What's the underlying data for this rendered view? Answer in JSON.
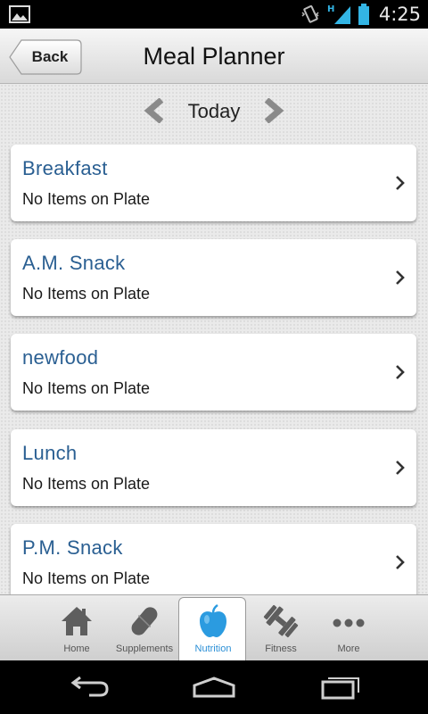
{
  "status_bar": {
    "time": "4:25",
    "network": "H",
    "icons": [
      "gallery-icon",
      "vibrate-icon",
      "signal-icon",
      "battery-icon"
    ]
  },
  "header": {
    "back_label": "Back",
    "title": "Meal Planner"
  },
  "date_nav": {
    "label": "Today"
  },
  "meals": [
    {
      "name": "Breakfast",
      "status": "No Items on Plate"
    },
    {
      "name": "A.M. Snack",
      "status": "No Items on Plate"
    },
    {
      "name": "newfood",
      "status": "No Items on Plate"
    },
    {
      "name": "Lunch",
      "status": "No Items on Plate"
    },
    {
      "name": "P.M. Snack",
      "status": "No Items on Plate"
    }
  ],
  "tabs": [
    {
      "label": "Home",
      "icon": "home-icon"
    },
    {
      "label": "Supplements",
      "icon": "pill-icon"
    },
    {
      "label": "Nutrition",
      "icon": "apple-icon",
      "active": true
    },
    {
      "label": "Fitness",
      "icon": "dumbbell-icon"
    },
    {
      "label": "More",
      "icon": "more-dots-icon"
    }
  ],
  "colors": {
    "meal_title": "#2a5f92",
    "active_tab": "#2b8fd6",
    "status_icons": "#33b5e5"
  }
}
